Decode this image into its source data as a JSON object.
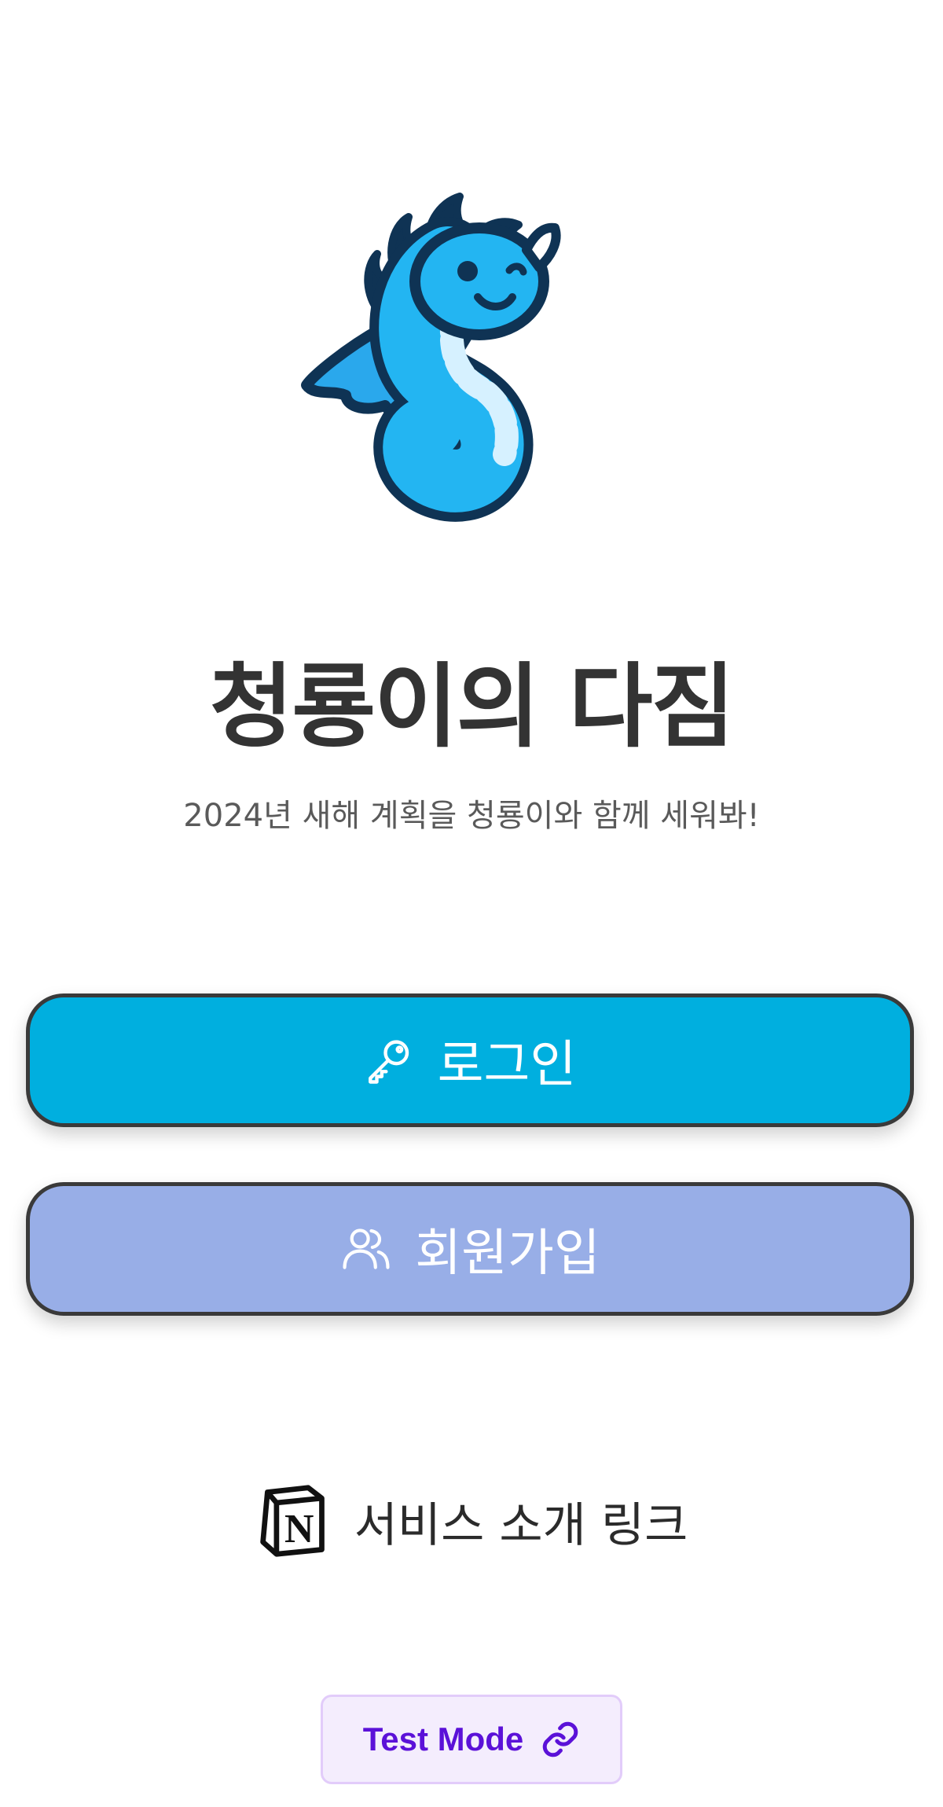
{
  "app": {
    "logo_icon": "blue-dragon-mascot-icon",
    "title": "청룡이의 다짐",
    "subtitle": "2024년 새해 계획을 청룡이와 함께 세워봐!"
  },
  "buttons": {
    "login": {
      "label": "로그인",
      "icon": "key-icon",
      "color": "#00afdf"
    },
    "signup": {
      "label": "회원가입",
      "icon": "users-icon",
      "color": "#98aee7"
    }
  },
  "service_link": {
    "label": "서비스 소개 링크",
    "icon": "notion-icon"
  },
  "test_mode": {
    "label": "Test Mode",
    "icon": "link-icon",
    "color": "#5b11d8"
  }
}
